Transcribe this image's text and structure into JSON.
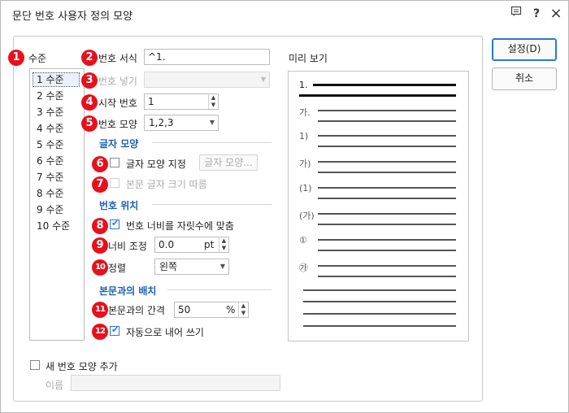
{
  "window": {
    "title": "문단 번호 사용자 정의 모양",
    "icons": [
      "comment-icon",
      "help-icon",
      "close-icon"
    ],
    "help_glyph": "?",
    "close_glyph": "×"
  },
  "buttons": {
    "ok": "설정(D)",
    "cancel": "취소"
  },
  "level": {
    "label": "수준",
    "items": [
      "1 수준",
      "2 수준",
      "3 수준",
      "4 수준",
      "5 수준",
      "6 수준",
      "7 수준",
      "8 수준",
      "9 수준",
      "10 수준"
    ],
    "selected_index": 0
  },
  "number_format": {
    "label": "번호 서식",
    "value": "^1."
  },
  "number_insert": {
    "label": "번호 넣기",
    "value": ""
  },
  "start_number": {
    "label": "시작 번호",
    "value": "1"
  },
  "number_shape": {
    "label": "번호 모양",
    "value": "1,2,3"
  },
  "char_shape": {
    "section": "글자 모양",
    "specify_label": "글자 모양 지정",
    "specify_checked": false,
    "button": "글자 모양...",
    "follow_label": "본문 글자 크기 따름",
    "follow_checked": false
  },
  "number_position": {
    "section": "번호 위치",
    "fit_label": "번호 너비를 자릿수에 맞춤",
    "fit_checked": true,
    "width_label": "너비 조정",
    "width_value": "0.0",
    "width_unit": "pt",
    "align_label": "정렬",
    "align_value": "왼쪽"
  },
  "body_layout": {
    "section": "본문과의 배치",
    "gap_label": "본문과의 간격",
    "gap_value": "50",
    "gap_unit": "%",
    "auto_label": "자동으로 내어 쓰기",
    "auto_checked": true
  },
  "new_shape": {
    "label": "새 번호 모양 추가",
    "checked": false,
    "name_label": "이름",
    "name_value": ""
  },
  "preview": {
    "label": "미리 보기",
    "markers": [
      "1.",
      "가.",
      "1)",
      "가)",
      "(1)",
      "(가)",
      "①",
      "㉮"
    ]
  },
  "badges": [
    "1",
    "2",
    "3",
    "4",
    "5",
    "6",
    "7",
    "8",
    "9",
    "10",
    "11",
    "12"
  ],
  "colors": {
    "badge": "#e8101c",
    "accent": "#2b78d6",
    "section": "#1b5fb4"
  }
}
